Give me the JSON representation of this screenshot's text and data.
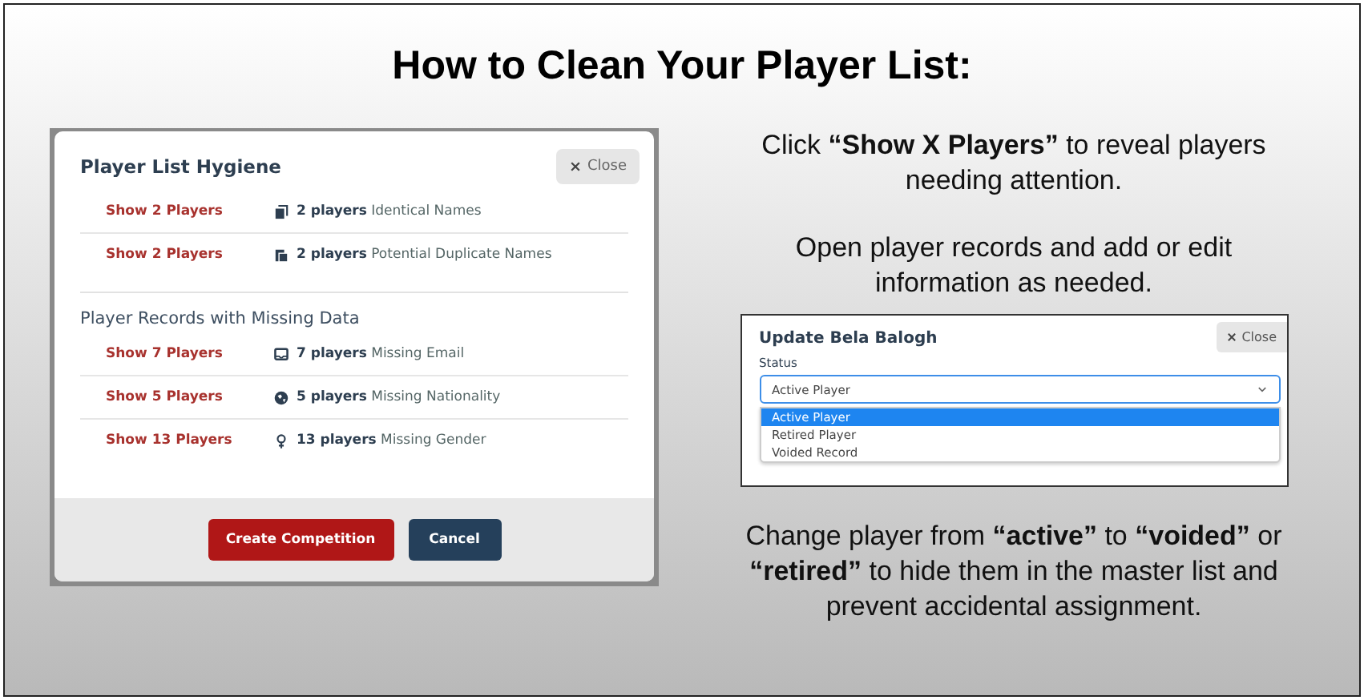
{
  "title": "How to Clean Your Player List:",
  "hygiene_modal": {
    "title": "Player List Hygiene",
    "close_button": "Close",
    "sections": [
      {
        "items": [
          {
            "link": "Show 2 Players",
            "kind": "copy",
            "count": "2 players",
            "label": "Identical Names"
          },
          {
            "link": "Show 2 Players",
            "kind": "duplicate",
            "count": "2 players",
            "label": "Potential Duplicate Names"
          }
        ]
      },
      {
        "heading": "Player Records with Missing Data",
        "items": [
          {
            "link": "Show 7 Players",
            "kind": "email",
            "count": "7 players",
            "label": "Missing Email"
          },
          {
            "link": "Show 5 Players",
            "kind": "globe",
            "count": "5 players",
            "label": "Missing Nationality"
          },
          {
            "link": "Show 13 Players",
            "kind": "gender",
            "count": "13 players",
            "label": "Missing Gender"
          }
        ]
      }
    ],
    "buttons": [
      {
        "label": "Create Competition",
        "kind": "primary"
      },
      {
        "label": "Cancel",
        "kind": "secondary"
      }
    ]
  },
  "steps": [
    "Click **“Show X Players”** to reveal players needing attention.",
    "Open player records and add or edit information as needed."
  ],
  "update_modal": {
    "title": "Update Bela Balogh",
    "close_button": "Close",
    "field_label": "Status",
    "value": "Active Player",
    "options": [
      {
        "label": "Active Player",
        "selected": true
      },
      {
        "label": "Retired Player",
        "selected": false
      },
      {
        "label": "Voided Record",
        "selected": false
      }
    ]
  },
  "note": "Change player from **“active”** to **“voided”** or **“retired”** to hide them in the master list and prevent accidental assignment."
}
